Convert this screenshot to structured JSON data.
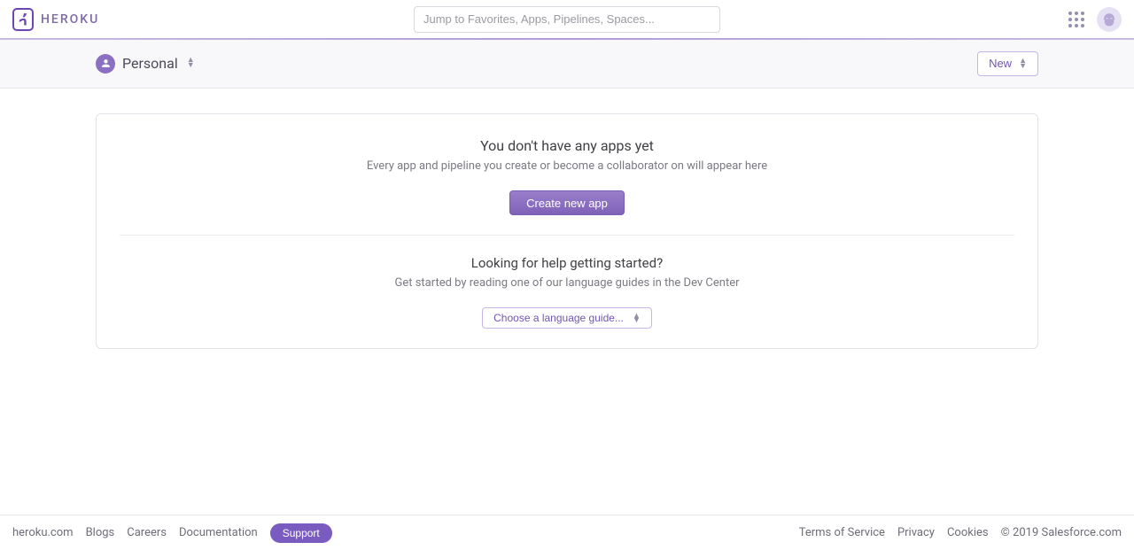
{
  "brand": {
    "name": "HEROKU"
  },
  "search": {
    "placeholder": "Jump to Favorites, Apps, Pipelines, Spaces..."
  },
  "subbar": {
    "workspace_label": "Personal",
    "new_label": "New"
  },
  "empty_state": {
    "title": "You don't have any apps yet",
    "subtitle": "Every app and pipeline you create or become a collaborator on will appear here",
    "create_label": "Create new app",
    "help_title": "Looking for help getting started?",
    "help_subtitle": "Get started by reading one of our language guides in the Dev Center",
    "guide_button": "Choose a language guide..."
  },
  "footer": {
    "links": {
      "home": "heroku.com",
      "blogs": "Blogs",
      "careers": "Careers",
      "docs": "Documentation"
    },
    "support_label": "Support",
    "legal": {
      "tos": "Terms of Service",
      "privacy": "Privacy",
      "cookies": "Cookies",
      "copyright": "© 2019 Salesforce.com"
    }
  }
}
